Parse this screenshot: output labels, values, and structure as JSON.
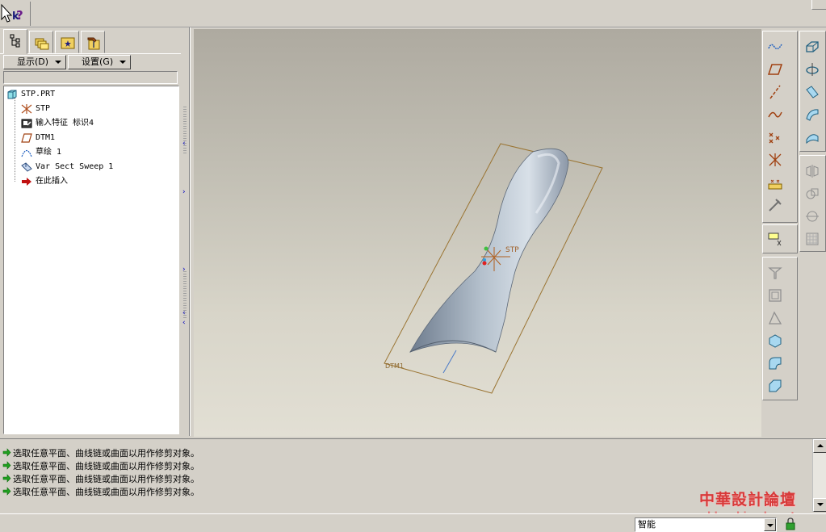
{
  "toolbar": {
    "help_icon": "context-help-icon"
  },
  "nav_tabs": [
    {
      "name": "model-tree",
      "icon": "model-tree-icon"
    },
    {
      "name": "folder-browser",
      "icon": "folder-browser-icon"
    },
    {
      "name": "favorites",
      "icon": "favorites-icon"
    },
    {
      "name": "connections",
      "icon": "connections-icon"
    }
  ],
  "tree_controls": {
    "display_label": "显示(D)",
    "settings_label": "设置(G)"
  },
  "model_tree": {
    "items": [
      {
        "label": "STP.PRT",
        "icon": "part-icon"
      },
      {
        "label": "STP",
        "icon": "coordinate-system-icon"
      },
      {
        "label": "输入特征 标识4",
        "icon": "import-feature-icon"
      },
      {
        "label": "DTM1",
        "icon": "datum-plane-icon"
      },
      {
        "label": "草绘 1",
        "icon": "sketch-icon"
      },
      {
        "label": "Var Sect Sweep 1",
        "icon": "sweep-icon"
      },
      {
        "label": "在此插入",
        "icon": "insert-here-arrow-icon"
      }
    ]
  },
  "viewport": {
    "datum_label": "DTM1",
    "csys_label": "STP",
    "colors": {
      "surface": "#a8b4c2",
      "datum": "#a07830"
    }
  },
  "datum_toolbar": {
    "icons": [
      "datum-curve-icon",
      "datum-plane-icon",
      "datum-axis-icon",
      "sketch-curve-icon",
      "datum-point-icon",
      "coordinate-system-icon",
      "analysis-feature-icon",
      "insert-feature-icon",
      "annotation-icon"
    ]
  },
  "feature_toolbar": {
    "icons": [
      "extrude-icon",
      "revolve-icon",
      "variable-section-sweep-icon",
      "blend-icon",
      "boundary-blend-icon",
      "mirror-icon",
      "merge-icon",
      "trim-icon",
      "pattern-icon",
      "thicken-icon",
      "offset-icon",
      "draft-icon",
      "solidify-icon",
      "round-icon",
      "chamfer-icon"
    ]
  },
  "messages": [
    "选取任意平面、曲线链或曲面以用作修剪对象。",
    "选取任意平面、曲线链或曲面以用作修剪对象。",
    "选取任意平面、曲线链或曲面以用作修剪对象。",
    "选取任意平面、曲线链或曲面以用作修剪对象。"
  ],
  "status_bar": {
    "selection_filter": "智能"
  },
  "watermark": {
    "title": "中華設計論壇",
    "url": "bbs.chinade.net"
  }
}
